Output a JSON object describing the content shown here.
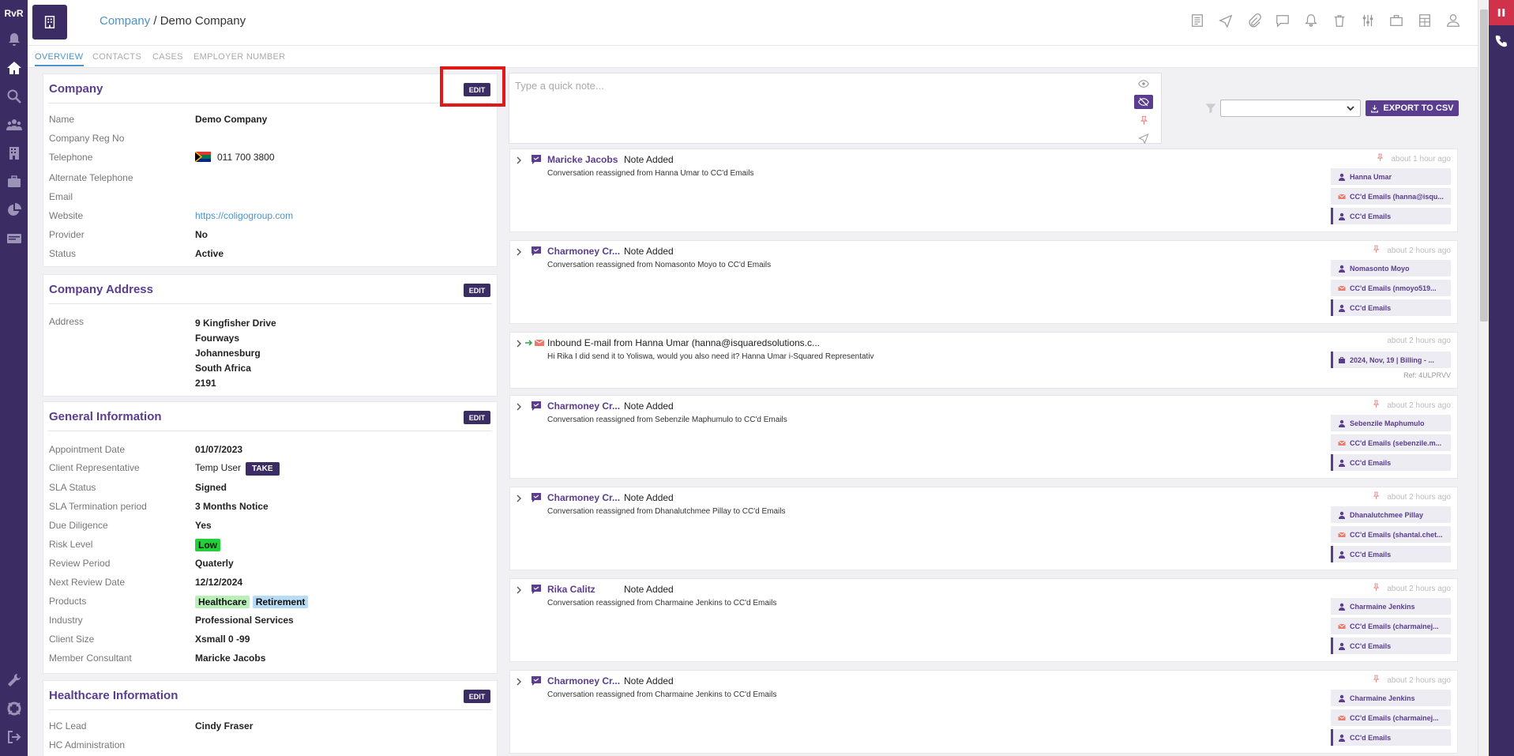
{
  "app": {
    "logo": "RvR"
  },
  "header": {
    "crumb_link": "Company",
    "crumb_sep": " / ",
    "crumb_current": "Demo Company"
  },
  "tabs": [
    "OVERVIEW",
    "CONTACTS",
    "CASES",
    "EMPLOYER NUMBER"
  ],
  "company": {
    "title": "Company",
    "edit": "EDIT",
    "name_label": "Name",
    "name": "Demo Company",
    "reg_label": "Company Reg No",
    "tel_label": "Telephone",
    "tel": "011 700 3800",
    "alt_tel_label": "Alternate Telephone",
    "email_label": "Email",
    "website_label": "Website",
    "website": "https://coligogroup.com",
    "provider_label": "Provider",
    "provider": "No",
    "status_label": "Status",
    "status": "Active"
  },
  "address": {
    "title": "Company Address",
    "edit": "EDIT",
    "label": "Address",
    "lines": [
      "9 Kingfisher Drive",
      "Fourways",
      "Johannesburg",
      "South Africa",
      "2191"
    ]
  },
  "general": {
    "title": "General Information",
    "edit": "EDIT",
    "appointment_label": "Appointment Date",
    "appointment": "01/07/2023",
    "rep_label": "Client Representative",
    "rep": "Temp User",
    "take": "TAKE",
    "sla_label": "SLA Status",
    "sla": "Signed",
    "slaterm_label": "SLA Termination period",
    "slaterm": "3 Months Notice",
    "dd_label": "Due Diligence",
    "dd": "Yes",
    "risk_label": "Risk Level",
    "risk": "Low",
    "review_label": "Review Period",
    "review": "Quaterly",
    "next_label": "Next Review Date",
    "next": "12/12/2024",
    "products_label": "Products",
    "product1": "Healthcare",
    "product2": "Retirement",
    "industry_label": "Industry",
    "industry": "Professional Services",
    "size_label": "Client Size",
    "size": "Xsmall 0 -99",
    "consultant_label": "Member Consultant",
    "consultant": "Maricke Jacobs"
  },
  "healthcare": {
    "title": "Healthcare Information",
    "edit": "EDIT",
    "lead_label": "HC Lead",
    "lead": "Cindy Fraser",
    "admin_label": "HC Administration"
  },
  "quicknote": {
    "placeholder": "Type a quick note..."
  },
  "export": {
    "label": "EXPORT TO CSV"
  },
  "activities": [
    {
      "who": "Maricke Jacobs",
      "what": "Note Added",
      "desc": "Conversation reassigned from Hanna Umar to CC'd Emails",
      "time": "about 1 hour ago",
      "tags": [
        "Hanna Umar",
        "CC'd Emails (hanna@isqu...",
        "CC'd Emails"
      ]
    },
    {
      "who": "Charmoney Cr...",
      "what": "Note Added",
      "desc": "Conversation reassigned from Nomasonto Moyo to CC'd Emails",
      "time": "about 2 hours ago",
      "tags": [
        "Nomasonto Moyo",
        "CC'd Emails (nmoyo519...",
        "CC'd Emails"
      ]
    },
    {
      "who": "",
      "what": "Inbound E-mail from Hanna Umar (hanna@isquaredsolutions.c...",
      "desc": "Hi Rika   I did send it to Yoliswa, would you also need it?   Hanna Umar i-Squared Representativ",
      "time": "about 2 hours ago",
      "tags": [
        "2024, Nov, 19 | Billing - ..."
      ],
      "ref": "Ref: 4ULPRVV"
    },
    {
      "who": "Charmoney Cr...",
      "what": "Note Added",
      "desc": "Conversation reassigned from Sebenzile Maphumulo to CC'd Emails",
      "time": "about 2 hours ago",
      "tags": [
        "Sebenzile Maphumulo",
        "CC'd Emails (sebenzile.m...",
        "CC'd Emails"
      ]
    },
    {
      "who": "Charmoney Cr...",
      "what": "Note Added",
      "desc": "Conversation reassigned from Dhanalutchmee Pillay to CC'd Emails",
      "time": "about 2 hours ago",
      "tags": [
        "Dhanalutchmee Pillay",
        "CC'd Emails (shantal.chet...",
        "CC'd Emails"
      ]
    },
    {
      "who": "Rika Calitz",
      "what": "Note Added",
      "desc": "Conversation reassigned from Charmaine Jenkins to CC'd Emails",
      "time": "about 2 hours ago",
      "tags": [
        "Charmaine Jenkins",
        "CC'd Emails (charmainej...",
        "CC'd Emails"
      ]
    },
    {
      "who": "Charmoney Cr...",
      "what": "Note Added",
      "desc": "Conversation reassigned from Charmaine Jenkins to CC'd Emails",
      "time": "about 2 hours ago",
      "tags": [
        "Charmaine Jenkins",
        "CC'd Emails (charmainej...",
        "CC'd Emails"
      ]
    }
  ],
  "colors": {
    "nav": "#3b2d63",
    "accent": "#5a3d8f",
    "link": "#4b93c9",
    "alert": "#d0314b",
    "risk_low": "#22d13a",
    "healthcare": "#b8f0b8",
    "retirement": "#b8dcf5"
  }
}
